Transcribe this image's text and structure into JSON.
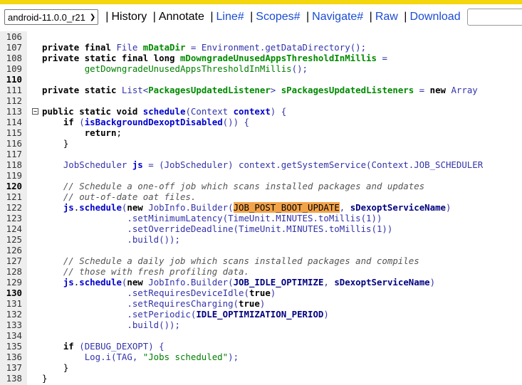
{
  "toolbar": {
    "revision": "android-11.0.0_r21",
    "revision_chevron": "❯",
    "items": [
      {
        "label": "History",
        "link": false
      },
      {
        "label": "Annotate",
        "link": false
      },
      {
        "label": "Line#",
        "link": true
      },
      {
        "label": "Scopes#",
        "link": true
      },
      {
        "label": "Navigate#",
        "link": true
      },
      {
        "label": "Raw",
        "link": true
      },
      {
        "label": "Download",
        "link": true
      }
    ],
    "search_placeholder": ""
  },
  "colors": {
    "top_strip": "#f4d60f",
    "gutter": "#eeeeee",
    "link": "#1a4bd4",
    "field": "#008a00",
    "method": "#0000cc",
    "type": "#3333aa",
    "highlight": "#f2a34a"
  },
  "code": {
    "fold_icon_line": 113,
    "lines": [
      {
        "n": "106",
        "bold": false,
        "tokens": []
      },
      {
        "n": "107",
        "bold": false,
        "tokens": [
          [
            "",
            "        "
          ],
          [
            "k",
            "private final "
          ],
          [
            "t",
            "File "
          ],
          [
            "f",
            "mDataDir"
          ],
          [
            "t",
            " = Environment.getDataDirectory();"
          ]
        ]
      },
      {
        "n": "108",
        "bold": false,
        "tokens": [
          [
            "",
            "        "
          ],
          [
            "k",
            "private static final long "
          ],
          [
            "f",
            "mDowngradeUnusedAppsThresholdInMillis"
          ],
          [
            "t",
            " ="
          ]
        ]
      },
      {
        "n": "109",
        "bold": false,
        "tokens": [
          [
            "",
            "                "
          ],
          [
            "s",
            "getDowngradeUnusedAppsThresholdInMillis"
          ],
          [
            "t",
            "();"
          ]
        ]
      },
      {
        "n": "110",
        "bold": true,
        "tokens": []
      },
      {
        "n": "111",
        "bold": false,
        "tokens": [
          [
            "",
            "        "
          ],
          [
            "k",
            "private static "
          ],
          [
            "t",
            "List<"
          ],
          [
            "f",
            "PackagesUpdatedListener"
          ],
          [
            "t",
            "> "
          ],
          [
            "f",
            "sPackagesUpdatedListeners"
          ],
          [
            "t",
            " = "
          ],
          [
            "k",
            "new "
          ],
          [
            "t",
            "Array"
          ]
        ]
      },
      {
        "n": "112",
        "bold": false,
        "tokens": []
      },
      {
        "n": "113",
        "bold": false,
        "tokens": [
          [
            "",
            "        "
          ],
          [
            "k",
            "public static void "
          ],
          [
            "m",
            "schedule"
          ],
          [
            "t",
            "(Context "
          ],
          [
            "m",
            "context"
          ],
          [
            "t",
            ") {"
          ]
        ]
      },
      {
        "n": "114",
        "bold": false,
        "tokens": [
          [
            "",
            "            "
          ],
          [
            "k",
            "if "
          ],
          [
            "t",
            "("
          ],
          [
            "m",
            "isBackgroundDexoptDisabled"
          ],
          [
            "t",
            "()) {"
          ]
        ]
      },
      {
        "n": "115",
        "bold": false,
        "tokens": [
          [
            "",
            "                "
          ],
          [
            "k",
            "return"
          ],
          [
            "n",
            ";"
          ]
        ]
      },
      {
        "n": "116",
        "bold": false,
        "tokens": [
          [
            "",
            "            "
          ],
          [
            "n",
            "}"
          ]
        ]
      },
      {
        "n": "117",
        "bold": false,
        "tokens": []
      },
      {
        "n": "118",
        "bold": false,
        "tokens": [
          [
            "",
            "            "
          ],
          [
            "t",
            "JobScheduler "
          ],
          [
            "m",
            "js"
          ],
          [
            "t",
            " = (JobScheduler) context.getSystemService(Context.JOB_SCHEDULER"
          ]
        ]
      },
      {
        "n": "119",
        "bold": false,
        "tokens": []
      },
      {
        "n": "120",
        "bold": true,
        "tokens": [
          [
            "",
            "            "
          ],
          [
            "c",
            "// Schedule a one-off job which scans installed packages and updates"
          ]
        ]
      },
      {
        "n": "121",
        "bold": false,
        "tokens": [
          [
            "",
            "            "
          ],
          [
            "c",
            "// out-of-date oat files."
          ]
        ]
      },
      {
        "n": "122",
        "bold": false,
        "tokens": [
          [
            "",
            "            "
          ],
          [
            "m",
            "js"
          ],
          [
            "n",
            "."
          ],
          [
            "m",
            "schedule"
          ],
          [
            "t",
            "("
          ],
          [
            "k",
            "new "
          ],
          [
            "t",
            "JobInfo.Builder("
          ],
          [
            "hl",
            "JOB_POST_BOOT_UPDATE"
          ],
          [
            "t",
            ", "
          ],
          [
            "cn",
            "sDexoptServiceName"
          ],
          [
            "t",
            ")"
          ]
        ]
      },
      {
        "n": "123",
        "bold": false,
        "tokens": [
          [
            "",
            "                        "
          ],
          [
            "t",
            ".setMinimumLatency(TimeUnit.MINUTES.toMillis(1))"
          ]
        ]
      },
      {
        "n": "124",
        "bold": false,
        "tokens": [
          [
            "",
            "                        "
          ],
          [
            "t",
            ".setOverrideDeadline(TimeUnit.MINUTES.toMillis(1))"
          ]
        ]
      },
      {
        "n": "125",
        "bold": false,
        "tokens": [
          [
            "",
            "                        "
          ],
          [
            "t",
            ".build());"
          ]
        ]
      },
      {
        "n": "126",
        "bold": false,
        "tokens": []
      },
      {
        "n": "127",
        "bold": false,
        "tokens": [
          [
            "",
            "            "
          ],
          [
            "c",
            "// Schedule a daily job which scans installed packages and compiles"
          ]
        ]
      },
      {
        "n": "128",
        "bold": false,
        "tokens": [
          [
            "",
            "            "
          ],
          [
            "c",
            "// those with fresh profiling data."
          ]
        ]
      },
      {
        "n": "129",
        "bold": false,
        "tokens": [
          [
            "",
            "            "
          ],
          [
            "m",
            "js"
          ],
          [
            "n",
            "."
          ],
          [
            "m",
            "schedule"
          ],
          [
            "t",
            "("
          ],
          [
            "k",
            "new "
          ],
          [
            "t",
            "JobInfo.Builder("
          ],
          [
            "cn",
            "JOB_IDLE_OPTIMIZE"
          ],
          [
            "t",
            ", "
          ],
          [
            "cn",
            "sDexoptServiceName"
          ],
          [
            "t",
            ")"
          ]
        ]
      },
      {
        "n": "130",
        "bold": true,
        "tokens": [
          [
            "",
            "                        "
          ],
          [
            "t",
            ".setRequiresDeviceIdle("
          ],
          [
            "k",
            "true"
          ],
          [
            "t",
            ")"
          ]
        ]
      },
      {
        "n": "131",
        "bold": false,
        "tokens": [
          [
            "",
            "                        "
          ],
          [
            "t",
            ".setRequiresCharging("
          ],
          [
            "k",
            "true"
          ],
          [
            "t",
            ")"
          ]
        ]
      },
      {
        "n": "132",
        "bold": false,
        "tokens": [
          [
            "",
            "                        "
          ],
          [
            "t",
            ".setPeriodic("
          ],
          [
            "cn",
            "IDLE_OPTIMIZATION_PERIOD"
          ],
          [
            "t",
            ")"
          ]
        ]
      },
      {
        "n": "133",
        "bold": false,
        "tokens": [
          [
            "",
            "                        "
          ],
          [
            "t",
            ".build());"
          ]
        ]
      },
      {
        "n": "134",
        "bold": false,
        "tokens": []
      },
      {
        "n": "135",
        "bold": false,
        "tokens": [
          [
            "",
            "            "
          ],
          [
            "k",
            "if "
          ],
          [
            "t",
            "(DEBUG_DEXOPT) {"
          ]
        ]
      },
      {
        "n": "136",
        "bold": false,
        "tokens": [
          [
            "",
            "                "
          ],
          [
            "t",
            "Log.i(TAG, "
          ],
          [
            "s",
            "\"Jobs scheduled\""
          ],
          [
            "t",
            ");"
          ]
        ]
      },
      {
        "n": "137",
        "bold": false,
        "tokens": [
          [
            "",
            "            "
          ],
          [
            "n",
            "}"
          ]
        ]
      },
      {
        "n": "138",
        "bold": false,
        "tokens": [
          [
            "",
            "        "
          ],
          [
            "n",
            "}"
          ]
        ]
      }
    ]
  }
}
